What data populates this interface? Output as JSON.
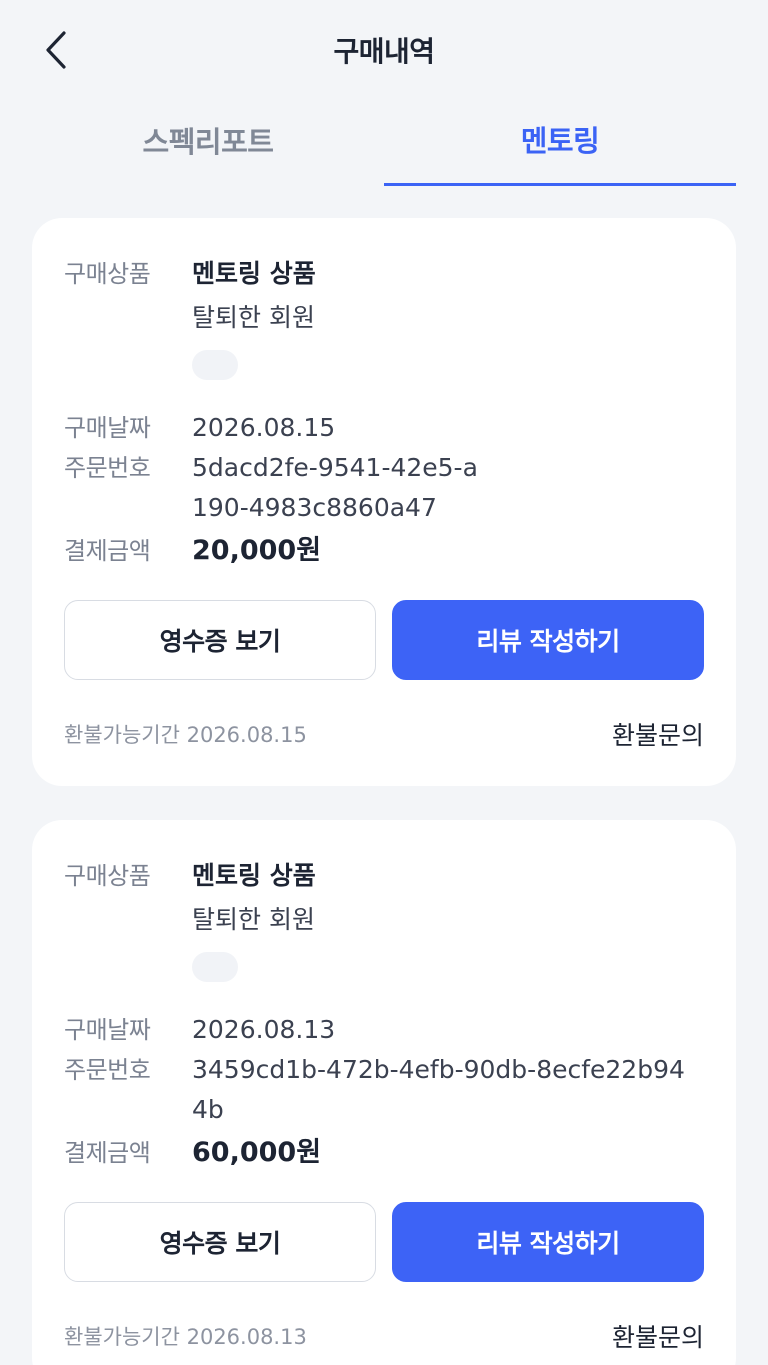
{
  "header": {
    "title": "구매내역",
    "back_icon": "chevron-left-icon"
  },
  "tabs": [
    {
      "label": "스펙리포트",
      "active": false
    },
    {
      "label": "멘토링",
      "active": true
    }
  ],
  "colors": {
    "accent": "#3d63f6",
    "background": "#f3f5f8",
    "card": "#ffffff"
  },
  "labels": {
    "product": "구매상품",
    "date": "구매날짜",
    "order_number": "주문번호",
    "amount": "결제금액",
    "receipt_button": "영수증 보기",
    "review_button": "리뷰 작성하기",
    "refund_inquiry": "환불문의"
  },
  "orders": [
    {
      "product_name": "멘토링 상품",
      "mentor": "탈퇴한 회원",
      "date": "2026.08.15",
      "order_id": "5dacd2fe-9541-42e5-a190-4983c8860a47",
      "amount": "20,000원",
      "refund_period": "환불가능기간 2026.08.15"
    },
    {
      "product_name": "멘토링 상품",
      "mentor": "탈퇴한 회원",
      "date": "2026.08.13",
      "order_id": "3459cd1b-472b-4efb-90db-8ecfe22b944b",
      "amount": "60,000원",
      "refund_period": "환불가능기간 2026.08.13"
    }
  ]
}
